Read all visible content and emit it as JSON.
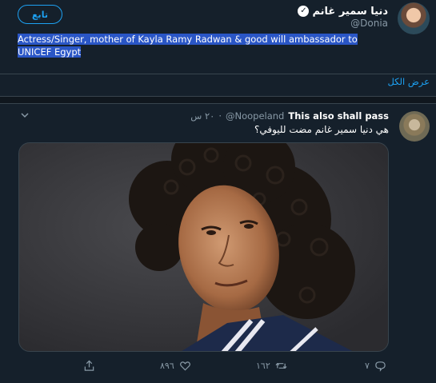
{
  "profile": {
    "display_name": "دنيا سمير غانم",
    "handle": "@Donia",
    "follow_label": "تابع",
    "bio": "Actress/Singer, mother of Kayla Ramy Radwan & good will ambassador to UNICEF Egypt",
    "verified": true
  },
  "show_all_label": "عرض الكل",
  "tweet": {
    "author_name": "This also shall pass",
    "author_handle": "@Noopeland",
    "time": "٢٠ س",
    "text": "هي دنيا سمير غانم مضت لليوفي؟",
    "actions": {
      "reply_count": "٧",
      "retweet_count": "١٦٢",
      "like_count": "٨٩٦",
      "share_count": ""
    }
  },
  "colors": {
    "background": "#15202b",
    "accent": "#1da1f2",
    "muted": "#8899a6",
    "selection": "#2a56c6"
  }
}
